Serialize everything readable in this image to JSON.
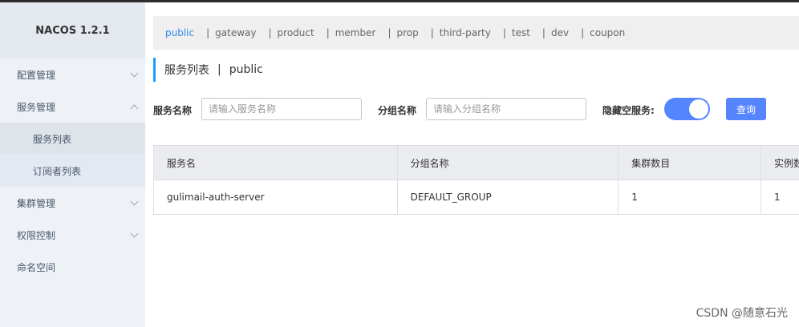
{
  "app": {
    "logo": "NACOS 1.2.1"
  },
  "sidebar": {
    "items": [
      {
        "label": "配置管理"
      },
      {
        "label": "服务管理"
      },
      {
        "label": "服务列表"
      },
      {
        "label": "订阅者列表"
      },
      {
        "label": "集群管理"
      },
      {
        "label": "权限控制"
      },
      {
        "label": "命名空间"
      }
    ]
  },
  "namespaces": {
    "items": [
      "public",
      "gateway",
      "product",
      "member",
      "prop",
      "third-party",
      "test",
      "dev",
      "coupon"
    ],
    "separator": "|",
    "active": "public"
  },
  "page": {
    "title": "服务列表",
    "sep": "|",
    "namespace": "public"
  },
  "filters": {
    "service_label": "服务名称",
    "service_placeholder": "请输入服务名称",
    "group_label": "分组名称",
    "group_placeholder": "请输入分组名称",
    "hide_empty_label": "隐藏空服务:",
    "hide_empty_on": true,
    "query_label": "查询"
  },
  "table": {
    "columns": [
      "服务名",
      "分组名称",
      "集群数目",
      "实例数"
    ],
    "rows": [
      [
        "gulimail-auth-server",
        "DEFAULT_GROUP",
        "1",
        "1"
      ]
    ]
  },
  "watermark": "CSDN @随意石光",
  "colors": {
    "accent": "#5584ff",
    "active_ns": "#2d8cf0",
    "title_bar": "#209bfa"
  }
}
